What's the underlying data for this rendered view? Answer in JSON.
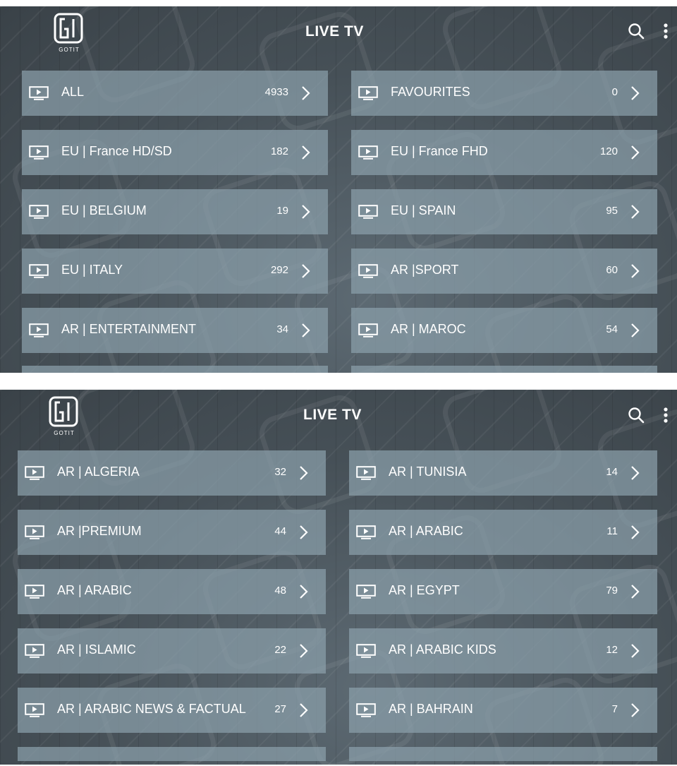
{
  "screens": [
    {
      "logo_text": "GOTIT",
      "title": "LIVE TV",
      "icons": {
        "search": "search-icon",
        "menu": "more-vert-icon",
        "tile": "tv-play-icon",
        "arrow": "chevron-right-icon"
      },
      "categories": [
        {
          "label": "ALL",
          "count": "4933"
        },
        {
          "label": "FAVOURITES",
          "count": "0"
        },
        {
          "label": "EU | France HD/SD",
          "count": "182"
        },
        {
          "label": "EU | France FHD",
          "count": "120"
        },
        {
          "label": "EU | BELGIUM",
          "count": "19"
        },
        {
          "label": "EU | SPAIN",
          "count": "95"
        },
        {
          "label": "EU | ITALY",
          "count": "292"
        },
        {
          "label": "AR |SPORT",
          "count": "60"
        },
        {
          "label": "AR | ENTERTAINMENT",
          "count": "34"
        },
        {
          "label": "AR | MAROC",
          "count": "54"
        }
      ]
    },
    {
      "logo_text": "GOTIT",
      "title": "LIVE TV",
      "icons": {
        "search": "search-icon",
        "menu": "more-vert-icon",
        "tile": "tv-play-icon",
        "arrow": "chevron-right-icon"
      },
      "categories": [
        {
          "label": "AR | ALGERIA",
          "count": "32"
        },
        {
          "label": "AR | TUNISIA",
          "count": "14"
        },
        {
          "label": "AR |PREMIUM",
          "count": "44"
        },
        {
          "label": "AR | ARABIC",
          "count": "11"
        },
        {
          "label": "AR | ARABIC",
          "count": "48"
        },
        {
          "label": "AR | EGYPT",
          "count": "79"
        },
        {
          "label": "AR | ISLAMIC",
          "count": "22"
        },
        {
          "label": "AR | ARABIC KIDS",
          "count": "12"
        },
        {
          "label": "AR | ARABIC NEWS & FACTUAL",
          "count": "27"
        },
        {
          "label": "AR | BAHRAIN",
          "count": "7"
        }
      ]
    }
  ],
  "colors": {
    "tile_bg": "#8aa0aa",
    "text": "#ffffff",
    "background": "#465057"
  }
}
